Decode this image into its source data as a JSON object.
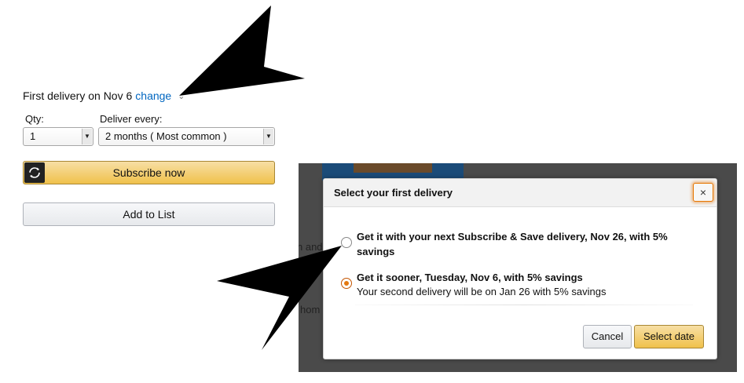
{
  "subscription": {
    "first_delivery_text": "First delivery on Nov 6",
    "change_link": "change",
    "qty_label": "Qty:",
    "qty_value": "1",
    "deliver_label": "Deliver every:",
    "deliver_value": "2 months ( Most common )",
    "subscribe_button": "Subscribe now",
    "add_to_list_button": "Add to List"
  },
  "background_fragments": [
    "n and",
    "tav",
    "hom"
  ],
  "modal": {
    "title": "Select your first delivery",
    "close_label": "×",
    "options": [
      {
        "title": "Get it with your next Subscribe & Save delivery, Nov 26, with 5% savings",
        "subtitle": "",
        "selected": false
      },
      {
        "title": "Get it sooner, Tuesday, Nov 6, with 5% savings",
        "subtitle": "Your second delivery will be on Jan 26 with 5% savings",
        "selected": true
      }
    ],
    "cancel_button": "Cancel",
    "confirm_button": "Select date"
  },
  "colors": {
    "link": "#0066c0",
    "primary_button": "#f0c14b",
    "radio_selected": "#e47911",
    "overlay": "#4a4a4a"
  },
  "icons": [
    "chevron-down-icon",
    "dropdown-arrow-icon",
    "subscribe-refresh-icon",
    "close-icon"
  ]
}
